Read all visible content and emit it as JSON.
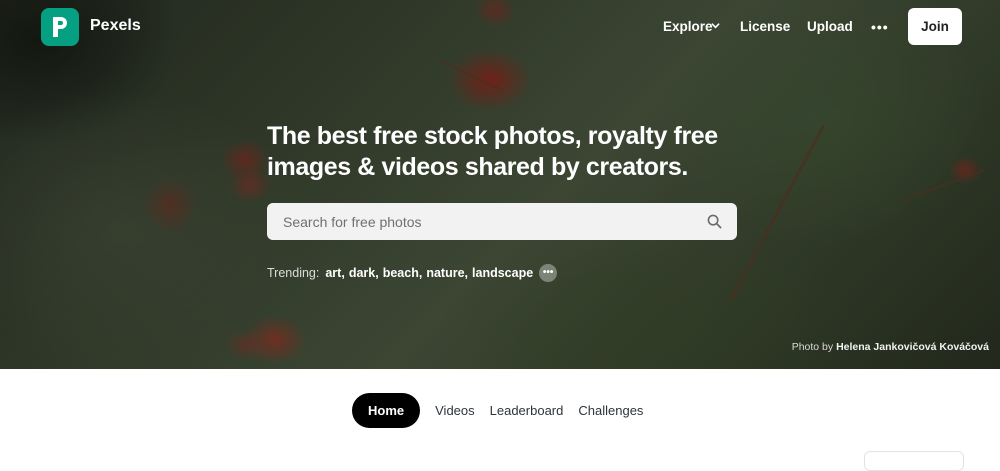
{
  "brand": {
    "name": "Pexels",
    "accent": "#05a081"
  },
  "nav": {
    "explore": "Explore",
    "license": "License",
    "upload": "Upload",
    "more": "•••",
    "join": "Join"
  },
  "hero": {
    "headline": "The best free stock photos, royalty free images & videos shared by creators.",
    "search_placeholder": "Search for free photos",
    "trending_label": "Trending:",
    "trending": [
      "art",
      "dark",
      "beach",
      "nature",
      "landscape"
    ],
    "trending_more": "•••",
    "credit_prefix": "Photo by",
    "credit_name": "Helena Jankovičová Kováčová"
  },
  "tabs": [
    {
      "label": "Home",
      "active": true
    },
    {
      "label": "Videos",
      "active": false
    },
    {
      "label": "Leaderboard",
      "active": false
    },
    {
      "label": "Challenges",
      "active": false
    }
  ]
}
